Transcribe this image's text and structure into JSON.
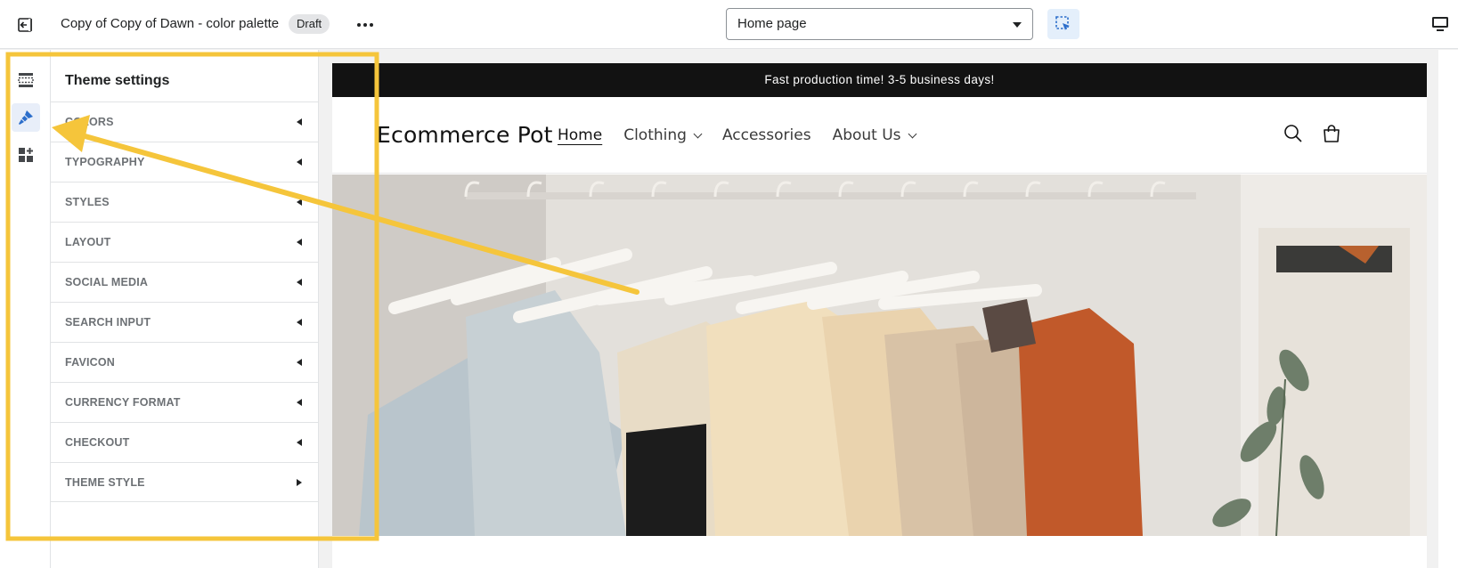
{
  "topbar": {
    "exit_icon": "exit-icon",
    "title": "Copy of Copy of Dawn - color palette",
    "status_badge": "Draft",
    "more_icon": "more-horizontal-icon",
    "page_select_value": "Home page",
    "inspector_icon": "inspector-select-icon",
    "device_icon": "desktop-icon"
  },
  "rail": {
    "items": [
      {
        "icon": "sections-icon",
        "active": false
      },
      {
        "icon": "theme-settings-brush-icon",
        "active": true
      },
      {
        "icon": "app-blocks-icon",
        "active": false
      }
    ]
  },
  "panel": {
    "title": "Theme settings",
    "items": [
      {
        "label": "COLORS",
        "expanded": false
      },
      {
        "label": "TYPOGRAPHY",
        "expanded": false
      },
      {
        "label": "STYLES",
        "expanded": false
      },
      {
        "label": "LAYOUT",
        "expanded": false
      },
      {
        "label": "SOCIAL MEDIA",
        "expanded": false
      },
      {
        "label": "SEARCH INPUT",
        "expanded": false
      },
      {
        "label": "FAVICON",
        "expanded": false
      },
      {
        "label": "CURRENCY FORMAT",
        "expanded": false
      },
      {
        "label": "CHECKOUT",
        "expanded": false
      },
      {
        "label": "THEME STYLE",
        "expanded": false
      }
    ]
  },
  "store": {
    "announcement": "Fast production time! 3-5 business days!",
    "logo": "Ecommerce Pot",
    "nav": [
      {
        "label": "Home",
        "current": true,
        "dropdown": false
      },
      {
        "label": "Clothing",
        "current": false,
        "dropdown": true
      },
      {
        "label": "Accessories",
        "current": false,
        "dropdown": false
      },
      {
        "label": "About Us",
        "current": false,
        "dropdown": true
      }
    ],
    "search_icon": "search-icon",
    "cart_icon": "cart-icon",
    "hero_image": "clothing-rack-hero-image"
  },
  "annotation": {
    "highlight_color": "#f5c53b"
  },
  "colors": {
    "accent_blue": "#2c6ecb",
    "announcement_bg": "#121212",
    "highlight": "#f5c53b"
  }
}
